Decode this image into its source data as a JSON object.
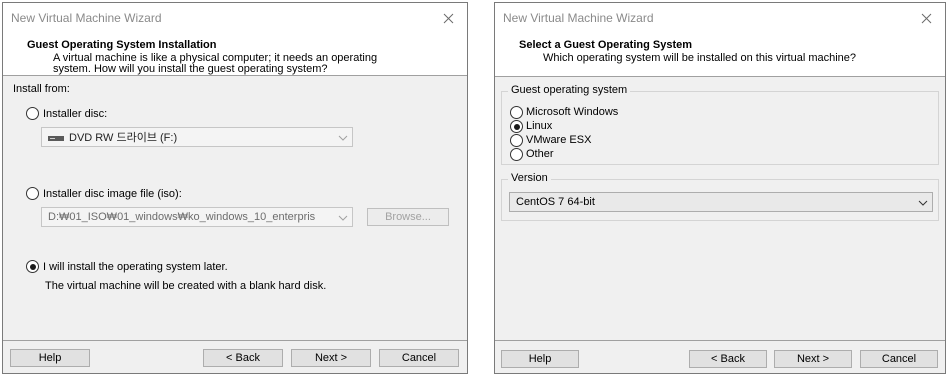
{
  "window1": {
    "title": "New Virtual Machine Wizard",
    "header_title": "Guest Operating System Installation",
    "header_sub_line1": "A virtual machine is like a physical computer; it needs an operating",
    "header_sub_line2": "system. How will you install the guest operating system?",
    "install_from_label": "Install from:",
    "installer_disc_label": "Installer disc:",
    "disc_drive_value": "DVD RW 드라이브 (F:)",
    "iso_label": "Installer disc image file (iso):",
    "iso_path_value": "D:₩01_ISO₩01_windows₩ko_windows_10_enterpris",
    "browse_label": "Browse...",
    "later_label": "I will install the operating system later.",
    "later_desc": "The virtual machine will be created with a blank hard disk.",
    "selected_option": "later",
    "help_label": "Help",
    "back_label": "< Back",
    "next_label": "Next >",
    "cancel_label": "Cancel"
  },
  "window2": {
    "title": "New Virtual Machine Wizard",
    "header_title": "Select a Guest Operating System",
    "header_sub": "Which operating system will be installed on this virtual machine?",
    "guest_os_group_label": "Guest operating system",
    "os_options": [
      "Microsoft Windows",
      "Linux",
      "VMware ESX",
      "Other"
    ],
    "selected_os": "Linux",
    "version_group_label": "Version",
    "version_value": "CentOS 7 64-bit",
    "help_label": "Help",
    "back_label": "< Back",
    "next_label": "Next >",
    "cancel_label": "Cancel"
  },
  "icons": {
    "close": "close-icon",
    "dropdown": "chevron-down-icon",
    "drive": "dvd-drive-icon"
  }
}
